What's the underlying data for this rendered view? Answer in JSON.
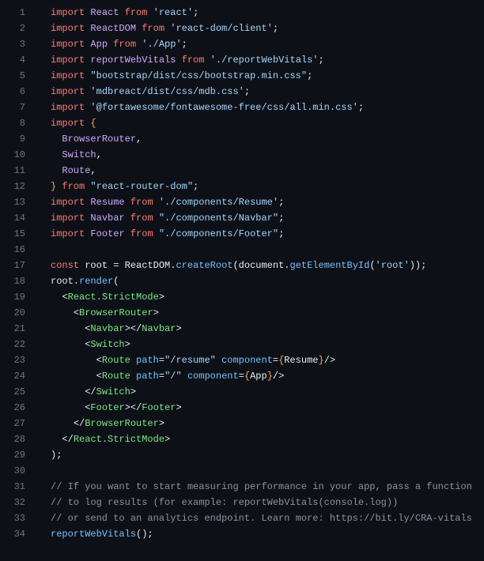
{
  "lines": [
    {
      "n": "1",
      "html": "<span class='kw'>import</span> <span class='def'>React</span> <span class='kw'>from</span> <span class='str'>'react'</span>;"
    },
    {
      "n": "2",
      "html": "<span class='kw'>import</span> <span class='def'>ReactDOM</span> <span class='kw'>from</span> <span class='str'>'react-dom/client'</span>;"
    },
    {
      "n": "3",
      "html": "<span class='kw'>import</span> <span class='def'>App</span> <span class='kw'>from</span> <span class='str'>'./App'</span>;"
    },
    {
      "n": "4",
      "html": "<span class='kw'>import</span> <span class='def'>reportWebVitals</span> <span class='kw'>from</span> <span class='str'>'./reportWebVitals'</span>;"
    },
    {
      "n": "5",
      "html": "<span class='kw'>import</span> <span class='str'>\"bootstrap/dist/css/bootstrap.min.css\"</span>;"
    },
    {
      "n": "6",
      "html": "<span class='kw'>import</span> <span class='str'>'mdbreact/dist/css/mdb.css'</span>;"
    },
    {
      "n": "7",
      "html": "<span class='kw'>import</span> <span class='str'>'@fortawesome/fontawesome-free/css/all.min.css'</span>;"
    },
    {
      "n": "8",
      "html": "<span class='kw'>import</span> <span class='brace'>{</span>"
    },
    {
      "n": "9",
      "html": "  <span class='def'>BrowserRouter</span>,"
    },
    {
      "n": "10",
      "html": "  <span class='def'>Switch</span>,"
    },
    {
      "n": "11",
      "html": "  <span class='def'>Route</span>,"
    },
    {
      "n": "12",
      "html": "<span class='brace'>}</span> <span class='kw'>from</span> <span class='str'>\"react-router-dom\"</span>;"
    },
    {
      "n": "13",
      "html": "<span class='kw'>import</span> <span class='def'>Resume</span> <span class='kw'>from</span> <span class='str'>'./components/Resume'</span>;"
    },
    {
      "n": "14",
      "html": "<span class='kw'>import</span> <span class='def'>Navbar</span> <span class='kw'>from</span> <span class='str'>\"./components/Navbar\"</span>;"
    },
    {
      "n": "15",
      "html": "<span class='kw'>import</span> <span class='def'>Footer</span> <span class='kw'>from</span> <span class='str'>\"./components/Footer\"</span>;"
    },
    {
      "n": "16",
      "html": ""
    },
    {
      "n": "17",
      "html": "<span class='kw'>const</span> <span class='obj'>root</span> <span class='punc'>=</span> <span class='obj'>ReactDOM</span><span class='punc'>.</span><span class='fn'>createRoot</span><span class='punc'>(</span><span class='obj'>document</span><span class='punc'>.</span><span class='fn'>getElementById</span><span class='punc'>(</span><span class='str'>'root'</span><span class='punc'>));</span>"
    },
    {
      "n": "18",
      "html": "<span class='obj'>root</span><span class='punc'>.</span><span class='fn'>render</span><span class='punc'>(</span>"
    },
    {
      "n": "19",
      "html": "  <span class='punc'>&lt;</span><span class='tag'>React.StrictMode</span><span class='punc'>&gt;</span>"
    },
    {
      "n": "20",
      "html": "    <span class='punc'>&lt;</span><span class='tag'>BrowserRouter</span><span class='punc'>&gt;</span>"
    },
    {
      "n": "21",
      "html": "      <span class='punc'>&lt;</span><span class='tag'>Navbar</span><span class='punc'>&gt;&lt;/</span><span class='tag'>Navbar</span><span class='punc'>&gt;</span>"
    },
    {
      "n": "22",
      "html": "      <span class='punc'>&lt;</span><span class='tag'>Switch</span><span class='punc'>&gt;</span>"
    },
    {
      "n": "23",
      "html": "        <span class='punc'>&lt;</span><span class='tag'>Route</span> <span class='attr'>path</span><span class='punc'>=</span><span class='str'>\"/resume\"</span> <span class='attr'>component</span><span class='punc'>=</span><span class='brace'>{</span><span class='obj'>Resume</span><span class='brace'>}</span><span class='punc'>/&gt;</span>"
    },
    {
      "n": "24",
      "html": "        <span class='punc'>&lt;</span><span class='tag'>Route</span> <span class='attr'>path</span><span class='punc'>=</span><span class='str'>\"/\"</span> <span class='attr'>component</span><span class='punc'>=</span><span class='brace'>{</span><span class='obj'>App</span><span class='brace'>}</span><span class='punc'>/&gt;</span>"
    },
    {
      "n": "25",
      "html": "      <span class='punc'>&lt;/</span><span class='tag'>Switch</span><span class='punc'>&gt;</span>"
    },
    {
      "n": "26",
      "html": "      <span class='punc'>&lt;</span><span class='tag'>Footer</span><span class='punc'>&gt;&lt;/</span><span class='tag'>Footer</span><span class='punc'>&gt;</span>"
    },
    {
      "n": "27",
      "html": "    <span class='punc'>&lt;/</span><span class='tag'>BrowserRouter</span><span class='punc'>&gt;</span>"
    },
    {
      "n": "28",
      "html": "  <span class='punc'>&lt;/</span><span class='tag'>React.StrictMode</span><span class='punc'>&gt;</span>"
    },
    {
      "n": "29",
      "html": "<span class='punc'>);</span>"
    },
    {
      "n": "30",
      "html": ""
    },
    {
      "n": "31",
      "html": "<span class='cmt'>// If you want to start measuring performance in your app, pass a function</span>"
    },
    {
      "n": "32",
      "html": "<span class='cmt'>// to log results (for example: reportWebVitals(console.log))</span>"
    },
    {
      "n": "33",
      "html": "<span class='cmt'>// or send to an analytics endpoint. Learn more: https://bit.ly/CRA-vitals</span>"
    },
    {
      "n": "34",
      "html": "<span class='fn'>reportWebVitals</span><span class='punc'>();</span>"
    }
  ]
}
